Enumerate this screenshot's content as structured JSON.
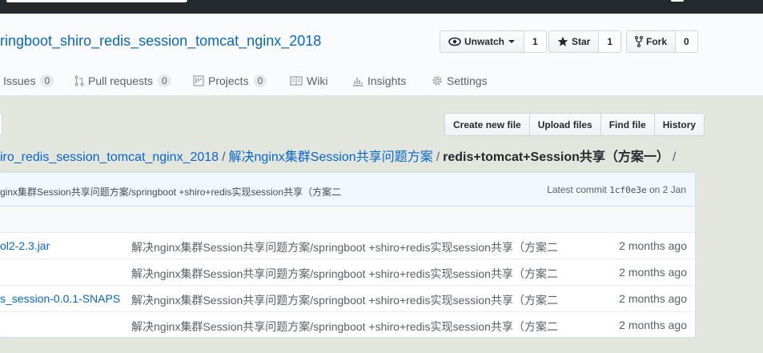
{
  "repo": {
    "title": "ringboot_shiro_redis_session_tomcat_nginx_2018"
  },
  "actions": {
    "watch_label": "Unwatch",
    "watch_count": "1",
    "star_label": "Star",
    "star_count": "1",
    "fork_label": "Fork",
    "fork_count": "0"
  },
  "tabs": [
    {
      "label": "Issues",
      "count": "0"
    },
    {
      "label": "Pull requests",
      "count": "0"
    },
    {
      "label": "Projects",
      "count": "0"
    },
    {
      "label": "Wiki"
    },
    {
      "label": "Insights"
    },
    {
      "label": "Settings"
    }
  ],
  "file_nav": {
    "create": "Create new file",
    "upload": "Upload files",
    "find": "Find file",
    "history": "History"
  },
  "breadcrumb": {
    "root": "iro_redis_session_tomcat_nginx_2018",
    "sep1": "/",
    "folder": "解决nginx集群Session共享问题方案",
    "sep2": "/",
    "current": "redis+tomcat+Session共享（方案一）",
    "sep3": "/"
  },
  "commit": {
    "message": "ginx集群Session共享问题方案/springboot +shiro+redis实现session共享（方案二",
    "latest_label": "Latest commit",
    "sha": "1cf0e3e",
    "date": "on 2 Jan"
  },
  "files": [
    {
      "name": "ol2-2.3.jar",
      "message": "解决nginx集群Session共享问题方案/springboot +shiro+redis实现session共享（方案二",
      "age": "2 months ago"
    },
    {
      "name": "",
      "message": "解决nginx集群Session共享问题方案/springboot +shiro+redis实现session共享（方案二",
      "age": "2 months ago"
    },
    {
      "name": "s_session-0.0.1-SNAPS…",
      "message": "解决nginx集群Session共享问题方案/springboot +shiro+redis实现session共享（方案二",
      "age": "2 months ago"
    },
    {
      "name": "",
      "message": "解决nginx集群Session共享问题方案/springboot +shiro+redis实现session共享（方案二",
      "age": "2 months ago"
    }
  ]
}
